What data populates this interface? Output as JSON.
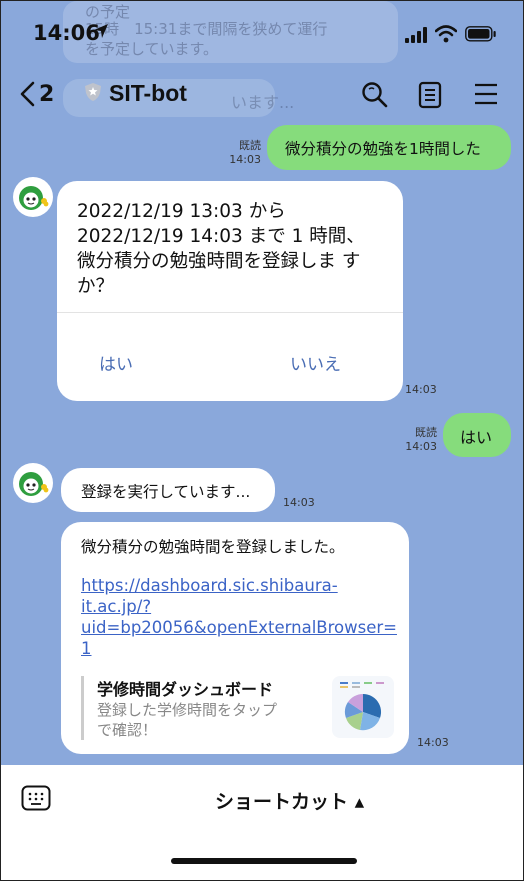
{
  "status_bar": {
    "time": "14:06"
  },
  "background_ghost": {
    "line1": "の予定",
    "line2": "15時　15:31まで間隔を狭めて運行",
    "line3": "を予定しています。",
    "header_text": "います..."
  },
  "header": {
    "back_count": "2",
    "title": "SIT-bot"
  },
  "messages": {
    "m1": {
      "text": "微分積分の勉強を1時間した",
      "read": "既読",
      "time": "14:03"
    },
    "m2": {
      "text_lines": [
        "2022/12/19 13:03 から",
        "2022/12/19 14:03 まで 1 時間、",
        "微分積分の勉強時間を登録しま す",
        "か？"
      ],
      "yes_label": "はい",
      "no_label": "いいえ",
      "time": "14:03"
    },
    "m3": {
      "text": "はい",
      "read": "既読",
      "time": "14:03"
    },
    "m4": {
      "text": "登録を実行しています...",
      "time": "14:03"
    },
    "m5": {
      "text": "微分積分の勉強時間を登録しました。",
      "link_lines": [
        "https://dashboard.sic.shibaura-",
        "it.ac.jp/?",
        "uid=bp20056&openExternalBrowser=",
        "1"
      ],
      "preview_title": "学修時間ダッシュボード",
      "preview_desc_lines": [
        "登録した学修時間をタップ",
        "で確認！"
      ],
      "time": "14:03"
    }
  },
  "bottom_bar": {
    "shortcut_label": "ショートカット ▴"
  },
  "colors": {
    "chat_bg": "#8aa8db",
    "sent_bubble": "#86dc7c",
    "link": "#3b63c6",
    "button_text": "#4a6db4"
  }
}
